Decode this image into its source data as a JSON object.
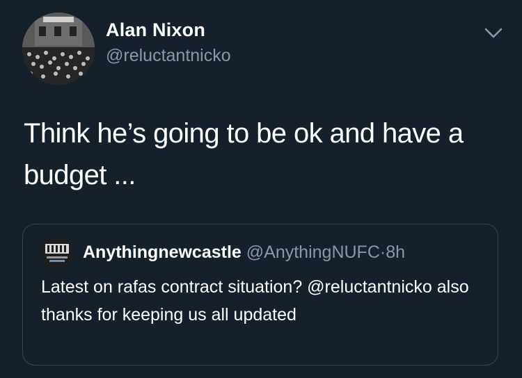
{
  "tweet": {
    "author_name": "Alan Nixon",
    "author_handle": "@reluctantnicko",
    "text": "Think he’s going to be ok and have a budget ...",
    "menu_icon": "chevron-down-icon"
  },
  "quoted_tweet": {
    "author_name": "Anythingnewcastle",
    "author_handle": "@AnythingNUFC",
    "separator": "·",
    "time": "8h",
    "text": "Latest on rafas contract situation? @reluctantnicko also thanks for keeping us all updated"
  },
  "colors": {
    "background": "#15202b",
    "secondary_text": "#8899a6",
    "border": "#38444d"
  }
}
